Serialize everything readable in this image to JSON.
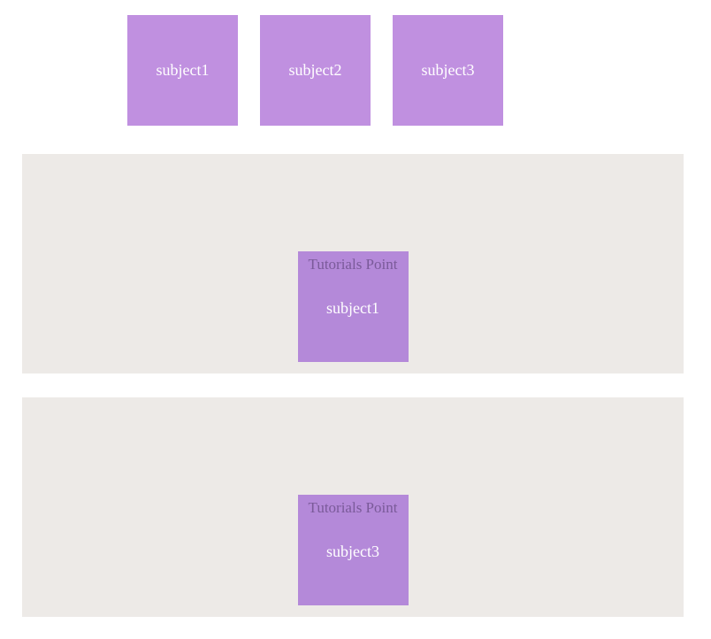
{
  "row1": {
    "cards": [
      {
        "label": "subject1"
      },
      {
        "label": "subject2"
      },
      {
        "label": "subject3"
      }
    ]
  },
  "panels": [
    {
      "title": "Tutorials Point",
      "label": "subject1"
    },
    {
      "title": "Tutorials Point",
      "label": "subject3"
    }
  ]
}
